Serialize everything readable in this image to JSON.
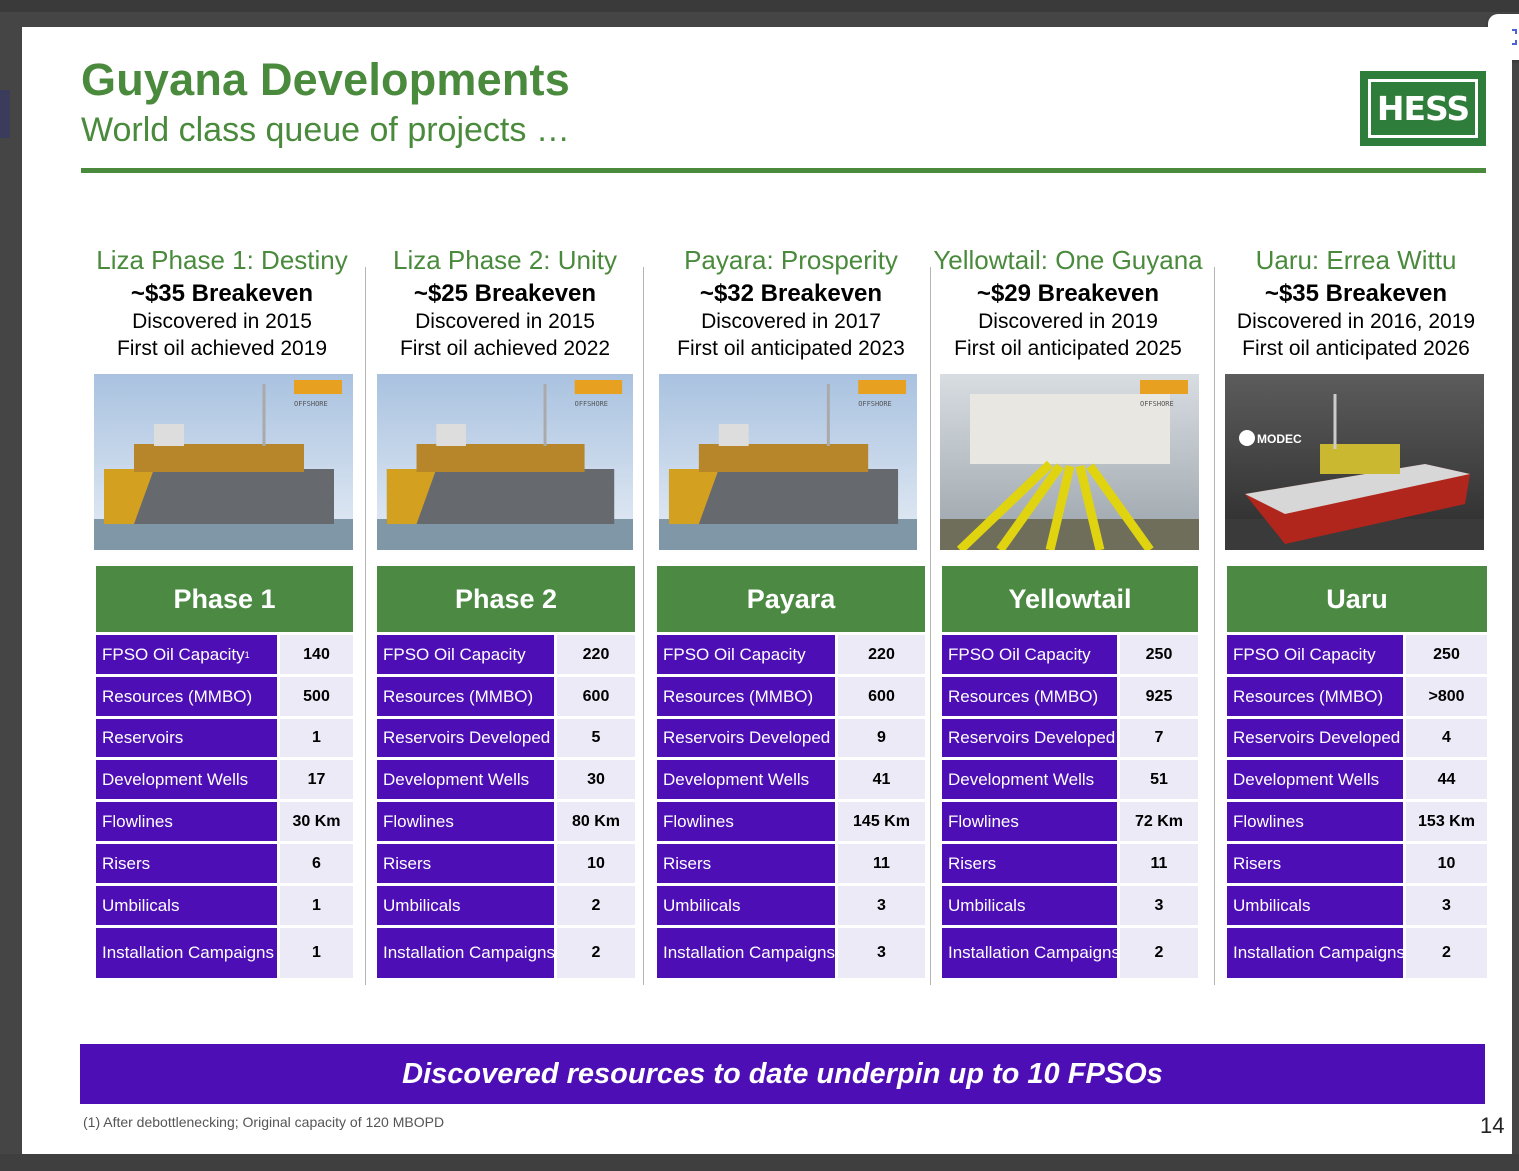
{
  "slide": {
    "title": "Guyana Developments",
    "subtitle": "World class queue of projects …",
    "logo_text": "HESS",
    "banner": "Discovered resources to date underpin up to 10 FPSOs",
    "footnote": "(1) After debottlenecking; Original capacity of 120 MBOPD",
    "page_number": "14"
  },
  "colors": {
    "green": "#4a8a3c",
    "purple": "#4d0fb5",
    "value_cell": "#ebeaf6"
  },
  "projects": [
    {
      "name": "Liza Phase 1: Destiny",
      "breakeven": "~$35 Breakeven",
      "discovered": "Discovered in 2015",
      "first_oil": "First oil achieved 2019",
      "image_badge": "SBM OFFSHORE",
      "table_title": "Phase 1",
      "rows": [
        {
          "label": "FPSO Oil Capacity",
          "sup": "1",
          "value": "140"
        },
        {
          "label": "Resources (MMBO)",
          "sup": "",
          "value": "500"
        },
        {
          "label": "Reservoirs",
          "sup": "",
          "value": "1"
        },
        {
          "label": "Development Wells",
          "sup": "",
          "value": "17"
        },
        {
          "label": "Flowlines",
          "sup": "",
          "value": "30 Km"
        },
        {
          "label": "Risers",
          "sup": "",
          "value": "6"
        },
        {
          "label": "Umbilicals",
          "sup": "",
          "value": "1"
        },
        {
          "label": "Installation Campaigns",
          "sup": "",
          "value": "1"
        }
      ]
    },
    {
      "name": "Liza Phase 2: Unity",
      "breakeven": "~$25 Breakeven",
      "discovered": "Discovered in 2015",
      "first_oil": "First oil achieved 2022",
      "image_badge": "SBM OFFSHORE",
      "table_title": "Phase 2",
      "rows": [
        {
          "label": "FPSO Oil Capacity",
          "sup": "",
          "value": "220"
        },
        {
          "label": "Resources (MMBO)",
          "sup": "",
          "value": "600"
        },
        {
          "label": "Reservoirs Developed",
          "sup": "",
          "value": "5"
        },
        {
          "label": "Development Wells",
          "sup": "",
          "value": "30"
        },
        {
          "label": "Flowlines",
          "sup": "",
          "value": "80 Km"
        },
        {
          "label": "Risers",
          "sup": "",
          "value": "10"
        },
        {
          "label": "Umbilicals",
          "sup": "",
          "value": "2"
        },
        {
          "label": "Installation Campaigns",
          "sup": "",
          "value": "2"
        }
      ]
    },
    {
      "name": "Payara: Prosperity",
      "breakeven": "~$32 Breakeven",
      "discovered": "Discovered in 2017",
      "first_oil": "First oil anticipated 2023",
      "image_badge": "SBM OFFSHORE",
      "table_title": "Payara",
      "rows": [
        {
          "label": "FPSO Oil Capacity",
          "sup": "",
          "value": "220"
        },
        {
          "label": "Resources (MMBO)",
          "sup": "",
          "value": "600"
        },
        {
          "label": "Reservoirs Developed",
          "sup": "",
          "value": "9"
        },
        {
          "label": "Development Wells",
          "sup": "",
          "value": "41"
        },
        {
          "label": "Flowlines",
          "sup": "",
          "value": "145 Km"
        },
        {
          "label": "Risers",
          "sup": "",
          "value": "11"
        },
        {
          "label": "Umbilicals",
          "sup": "",
          "value": "3"
        },
        {
          "label": "Installation Campaigns",
          "sup": "",
          "value": "3"
        }
      ]
    },
    {
      "name": "Yellowtail: One Guyana",
      "breakeven": "~$29 Breakeven",
      "discovered": "Discovered in 2019",
      "first_oil": "First oil anticipated 2025",
      "image_badge": "SBM OFFSHORE",
      "table_title": "Yellowtail",
      "rows": [
        {
          "label": "FPSO Oil Capacity",
          "sup": "",
          "value": "250"
        },
        {
          "label": "Resources (MMBO)",
          "sup": "",
          "value": "925"
        },
        {
          "label": "Reservoirs Developed",
          "sup": "",
          "value": "7"
        },
        {
          "label": "Development Wells",
          "sup": "",
          "value": "51"
        },
        {
          "label": "Flowlines",
          "sup": "",
          "value": "72 Km"
        },
        {
          "label": "Risers",
          "sup": "",
          "value": "11"
        },
        {
          "label": "Umbilicals",
          "sup": "",
          "value": "3"
        },
        {
          "label": "Installation Campaigns",
          "sup": "",
          "value": "2"
        }
      ]
    },
    {
      "name": "Uaru: Errea Wittu",
      "breakeven": "~$35 Breakeven",
      "discovered": "Discovered in 2016, 2019",
      "first_oil": "First oil anticipated 2026",
      "image_badge": "MODEC",
      "table_title": "Uaru",
      "rows": [
        {
          "label": "FPSO Oil Capacity",
          "sup": "",
          "value": "250"
        },
        {
          "label": "Resources (MMBO)",
          "sup": "",
          "value": ">800"
        },
        {
          "label": "Reservoirs Developed",
          "sup": "",
          "value": "4"
        },
        {
          "label": "Development Wells",
          "sup": "",
          "value": "44"
        },
        {
          "label": "Flowlines",
          "sup": "",
          "value": "153 Km"
        },
        {
          "label": "Risers",
          "sup": "",
          "value": "10"
        },
        {
          "label": "Umbilicals",
          "sup": "",
          "value": "3"
        },
        {
          "label": "Installation Campaigns",
          "sup": "",
          "value": "2"
        }
      ]
    }
  ]
}
